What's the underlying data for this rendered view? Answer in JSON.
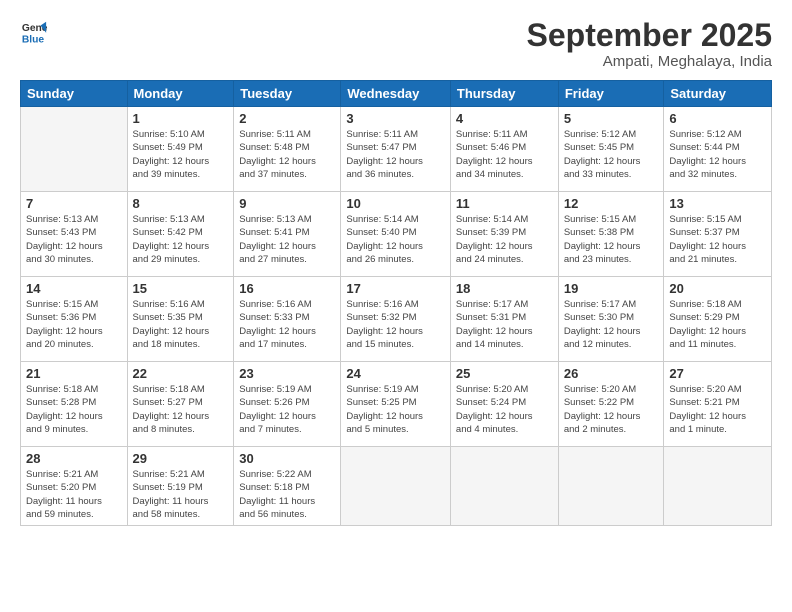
{
  "logo": {
    "line1": "General",
    "line2": "Blue"
  },
  "title": "September 2025",
  "location": "Ampati, Meghalaya, India",
  "days_header": [
    "Sunday",
    "Monday",
    "Tuesday",
    "Wednesday",
    "Thursday",
    "Friday",
    "Saturday"
  ],
  "weeks": [
    [
      {
        "day": "",
        "info": ""
      },
      {
        "day": "1",
        "info": "Sunrise: 5:10 AM\nSunset: 5:49 PM\nDaylight: 12 hours\nand 39 minutes."
      },
      {
        "day": "2",
        "info": "Sunrise: 5:11 AM\nSunset: 5:48 PM\nDaylight: 12 hours\nand 37 minutes."
      },
      {
        "day": "3",
        "info": "Sunrise: 5:11 AM\nSunset: 5:47 PM\nDaylight: 12 hours\nand 36 minutes."
      },
      {
        "day": "4",
        "info": "Sunrise: 5:11 AM\nSunset: 5:46 PM\nDaylight: 12 hours\nand 34 minutes."
      },
      {
        "day": "5",
        "info": "Sunrise: 5:12 AM\nSunset: 5:45 PM\nDaylight: 12 hours\nand 33 minutes."
      },
      {
        "day": "6",
        "info": "Sunrise: 5:12 AM\nSunset: 5:44 PM\nDaylight: 12 hours\nand 32 minutes."
      }
    ],
    [
      {
        "day": "7",
        "info": "Sunrise: 5:13 AM\nSunset: 5:43 PM\nDaylight: 12 hours\nand 30 minutes."
      },
      {
        "day": "8",
        "info": "Sunrise: 5:13 AM\nSunset: 5:42 PM\nDaylight: 12 hours\nand 29 minutes."
      },
      {
        "day": "9",
        "info": "Sunrise: 5:13 AM\nSunset: 5:41 PM\nDaylight: 12 hours\nand 27 minutes."
      },
      {
        "day": "10",
        "info": "Sunrise: 5:14 AM\nSunset: 5:40 PM\nDaylight: 12 hours\nand 26 minutes."
      },
      {
        "day": "11",
        "info": "Sunrise: 5:14 AM\nSunset: 5:39 PM\nDaylight: 12 hours\nand 24 minutes."
      },
      {
        "day": "12",
        "info": "Sunrise: 5:15 AM\nSunset: 5:38 PM\nDaylight: 12 hours\nand 23 minutes."
      },
      {
        "day": "13",
        "info": "Sunrise: 5:15 AM\nSunset: 5:37 PM\nDaylight: 12 hours\nand 21 minutes."
      }
    ],
    [
      {
        "day": "14",
        "info": "Sunrise: 5:15 AM\nSunset: 5:36 PM\nDaylight: 12 hours\nand 20 minutes."
      },
      {
        "day": "15",
        "info": "Sunrise: 5:16 AM\nSunset: 5:35 PM\nDaylight: 12 hours\nand 18 minutes."
      },
      {
        "day": "16",
        "info": "Sunrise: 5:16 AM\nSunset: 5:33 PM\nDaylight: 12 hours\nand 17 minutes."
      },
      {
        "day": "17",
        "info": "Sunrise: 5:16 AM\nSunset: 5:32 PM\nDaylight: 12 hours\nand 15 minutes."
      },
      {
        "day": "18",
        "info": "Sunrise: 5:17 AM\nSunset: 5:31 PM\nDaylight: 12 hours\nand 14 minutes."
      },
      {
        "day": "19",
        "info": "Sunrise: 5:17 AM\nSunset: 5:30 PM\nDaylight: 12 hours\nand 12 minutes."
      },
      {
        "day": "20",
        "info": "Sunrise: 5:18 AM\nSunset: 5:29 PM\nDaylight: 12 hours\nand 11 minutes."
      }
    ],
    [
      {
        "day": "21",
        "info": "Sunrise: 5:18 AM\nSunset: 5:28 PM\nDaylight: 12 hours\nand 9 minutes."
      },
      {
        "day": "22",
        "info": "Sunrise: 5:18 AM\nSunset: 5:27 PM\nDaylight: 12 hours\nand 8 minutes."
      },
      {
        "day": "23",
        "info": "Sunrise: 5:19 AM\nSunset: 5:26 PM\nDaylight: 12 hours\nand 7 minutes."
      },
      {
        "day": "24",
        "info": "Sunrise: 5:19 AM\nSunset: 5:25 PM\nDaylight: 12 hours\nand 5 minutes."
      },
      {
        "day": "25",
        "info": "Sunrise: 5:20 AM\nSunset: 5:24 PM\nDaylight: 12 hours\nand 4 minutes."
      },
      {
        "day": "26",
        "info": "Sunrise: 5:20 AM\nSunset: 5:22 PM\nDaylight: 12 hours\nand 2 minutes."
      },
      {
        "day": "27",
        "info": "Sunrise: 5:20 AM\nSunset: 5:21 PM\nDaylight: 12 hours\nand 1 minute."
      }
    ],
    [
      {
        "day": "28",
        "info": "Sunrise: 5:21 AM\nSunset: 5:20 PM\nDaylight: 11 hours\nand 59 minutes."
      },
      {
        "day": "29",
        "info": "Sunrise: 5:21 AM\nSunset: 5:19 PM\nDaylight: 11 hours\nand 58 minutes."
      },
      {
        "day": "30",
        "info": "Sunrise: 5:22 AM\nSunset: 5:18 PM\nDaylight: 11 hours\nand 56 minutes."
      },
      {
        "day": "",
        "info": ""
      },
      {
        "day": "",
        "info": ""
      },
      {
        "day": "",
        "info": ""
      },
      {
        "day": "",
        "info": ""
      }
    ]
  ]
}
